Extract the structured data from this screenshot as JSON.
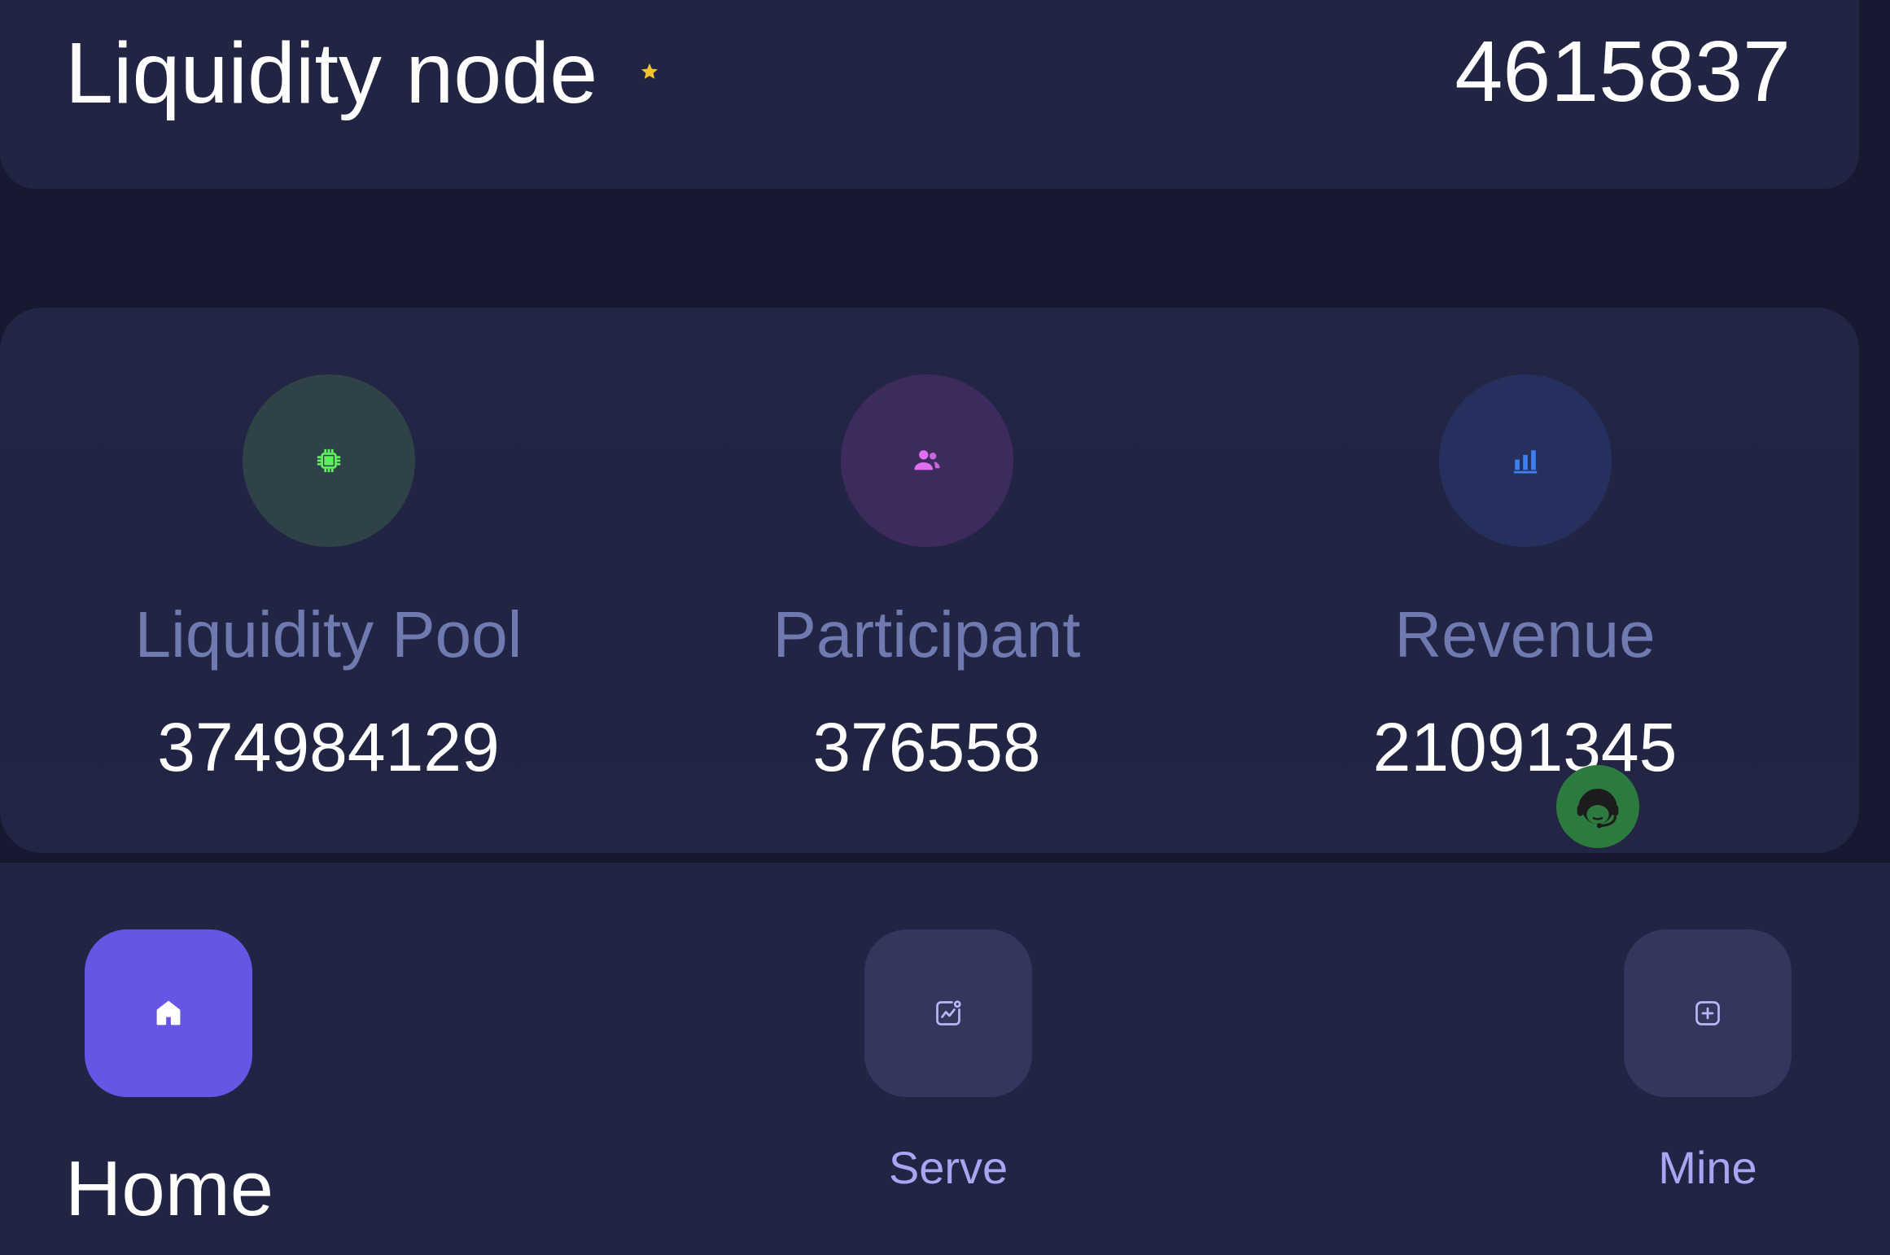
{
  "header": {
    "title": "Liquidity node",
    "value": "4615837",
    "star_icon": "star-icon",
    "star_color": "#f4c430"
  },
  "stats": [
    {
      "label": "Liquidity Pool",
      "value": "374984129",
      "icon": "chip-icon",
      "icon_color": "#5ff05f",
      "circle_color": "#2e4247"
    },
    {
      "label": "Participant",
      "value": "376558",
      "icon": "users-icon",
      "icon_color": "#e36ef0",
      "circle_color": "#3d2b5e"
    },
    {
      "label": "Revenue",
      "value": "21091345",
      "icon": "bar-chart-icon",
      "icon_color": "#3d7ff0",
      "circle_color": "#25305e"
    }
  ],
  "support": {
    "icon": "customer-support-icon",
    "color": "#2d7a3e"
  },
  "nav": {
    "items": [
      {
        "label": "Home",
        "icon": "home-icon",
        "active": true,
        "bg": "#6656e6"
      },
      {
        "label": "Serve",
        "icon": "chart-card-icon",
        "active": false,
        "bg": "#34365d"
      },
      {
        "label": "Mine",
        "icon": "plus-square-icon",
        "active": false,
        "bg": "#34365d"
      }
    ]
  },
  "colors": {
    "background": "#171931",
    "card": "#222443",
    "label_muted": "#6f7bb0",
    "nav_inactive_text": "#a7a6f2"
  }
}
